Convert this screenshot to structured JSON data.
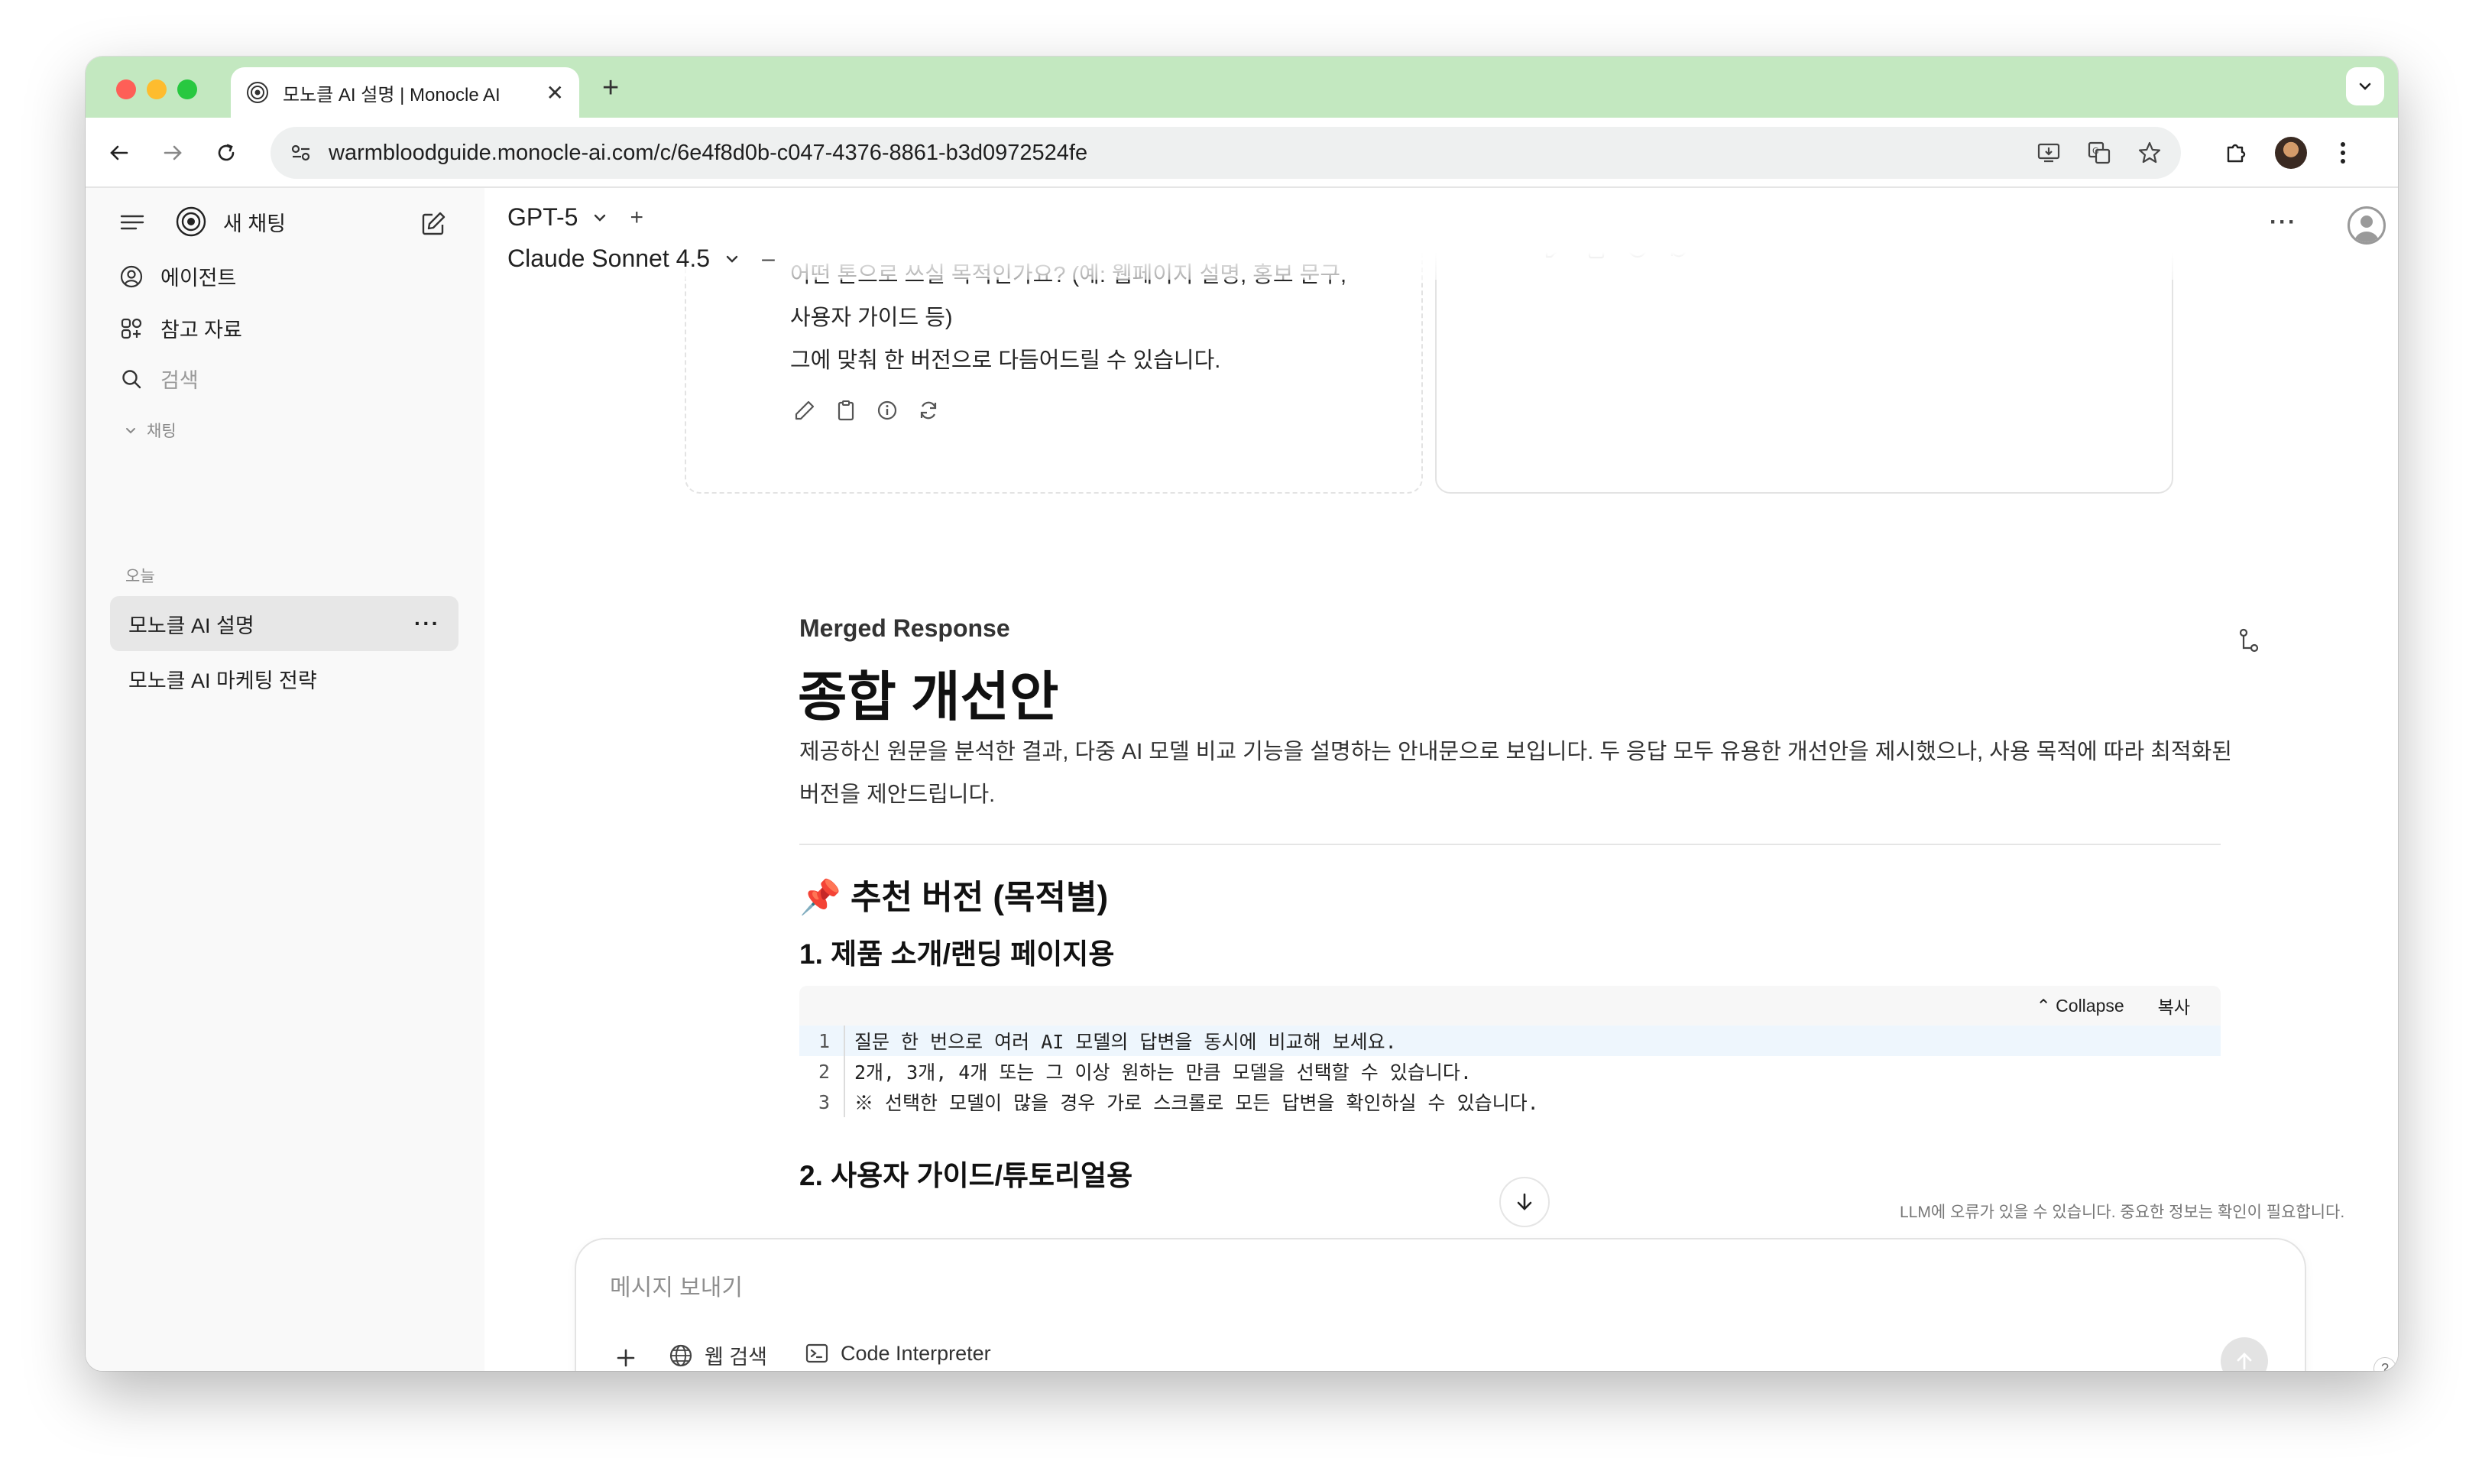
{
  "browser": {
    "tab_title": "모노클 AI 설명 | Monocle AI",
    "new_tab_label": "+",
    "tab_close_label": "✕",
    "url": "warmbloodguide.monocle-ai.com/c/6e4f8d0b-c047-4376-8861-b3d0972524fe"
  },
  "sidebar": {
    "new_chat_label": "새 채팅",
    "items": [
      {
        "label": "에이전트",
        "icon": "agent-icon"
      },
      {
        "label": "참고 자료",
        "icon": "grid-icon"
      },
      {
        "label": "검색",
        "icon": "search-icon"
      }
    ],
    "chats_section_label": "채팅",
    "today_label": "오늘",
    "conversations": [
      {
        "title": "모노클 AI 설명",
        "active": true,
        "more": "···"
      },
      {
        "title": "모노클 AI 마케팅 전략",
        "active": false
      }
    ]
  },
  "header": {
    "models": [
      "GPT-5",
      "Claude Sonnet 4.5"
    ],
    "add_label": "+",
    "remove_label": "–",
    "more_label": "···"
  },
  "left_card": {
    "text_lines": [
      "어떤 톤으로 쓰실 목적인가요? (예: 웹페이지 설명, 홍보 문구,",
      "사용자 가이드 등)",
      "그에 맞춰 한 버전으로 다듬어드릴 수 있습니다."
    ]
  },
  "merged": {
    "label": "Merged Response",
    "title": "종합 개선안",
    "intro": "제공하신 원문을 분석한 결과, 다중 AI 모델 비교 기능을 설명하는 안내문으로 보입니다. 두 응답 모두 유용한 개선안을 제시했으나, 사용 목적에 따라 최적화된 버전을 제안드립니다.",
    "section_title": "📌 추천 버전 (목적별)",
    "sub1": "1. 제품 소개/랜딩 페이지용",
    "sub2": "2. 사용자 가이드/튜토리얼용",
    "code": {
      "collapse_label": "⌃ Collapse",
      "copy_label": "복사",
      "lines": [
        {
          "n": "1",
          "text": "질문 한 번으로 여러 AI 모델의 답변을 동시에 비교해 보세요."
        },
        {
          "n": "2",
          "text": "2개, 3개, 4개 또는 그 이상 원하는 만큼 모델을 선택할 수 있습니다."
        },
        {
          "n": "3",
          "text": "※ 선택한 모델이 많을 경우 가로 스크롤로 모든 답변을 확인하실 수 있습니다."
        }
      ]
    }
  },
  "disclaimer": "LLM에 오류가 있을 수 있습니다. 중요한 정보는 확인이 필요합니다.",
  "composer": {
    "placeholder": "메시지 보내기",
    "web_search_label": "웹 검색",
    "code_interpreter_label": "Code Interpreter"
  },
  "help_label": "?",
  "colors": {
    "tabbar_bg": "#c3e8c0",
    "sidebar_bg": "#f9f9f9",
    "active_item_bg": "#e7e7e7",
    "code_highlight": "#eef6fd"
  }
}
